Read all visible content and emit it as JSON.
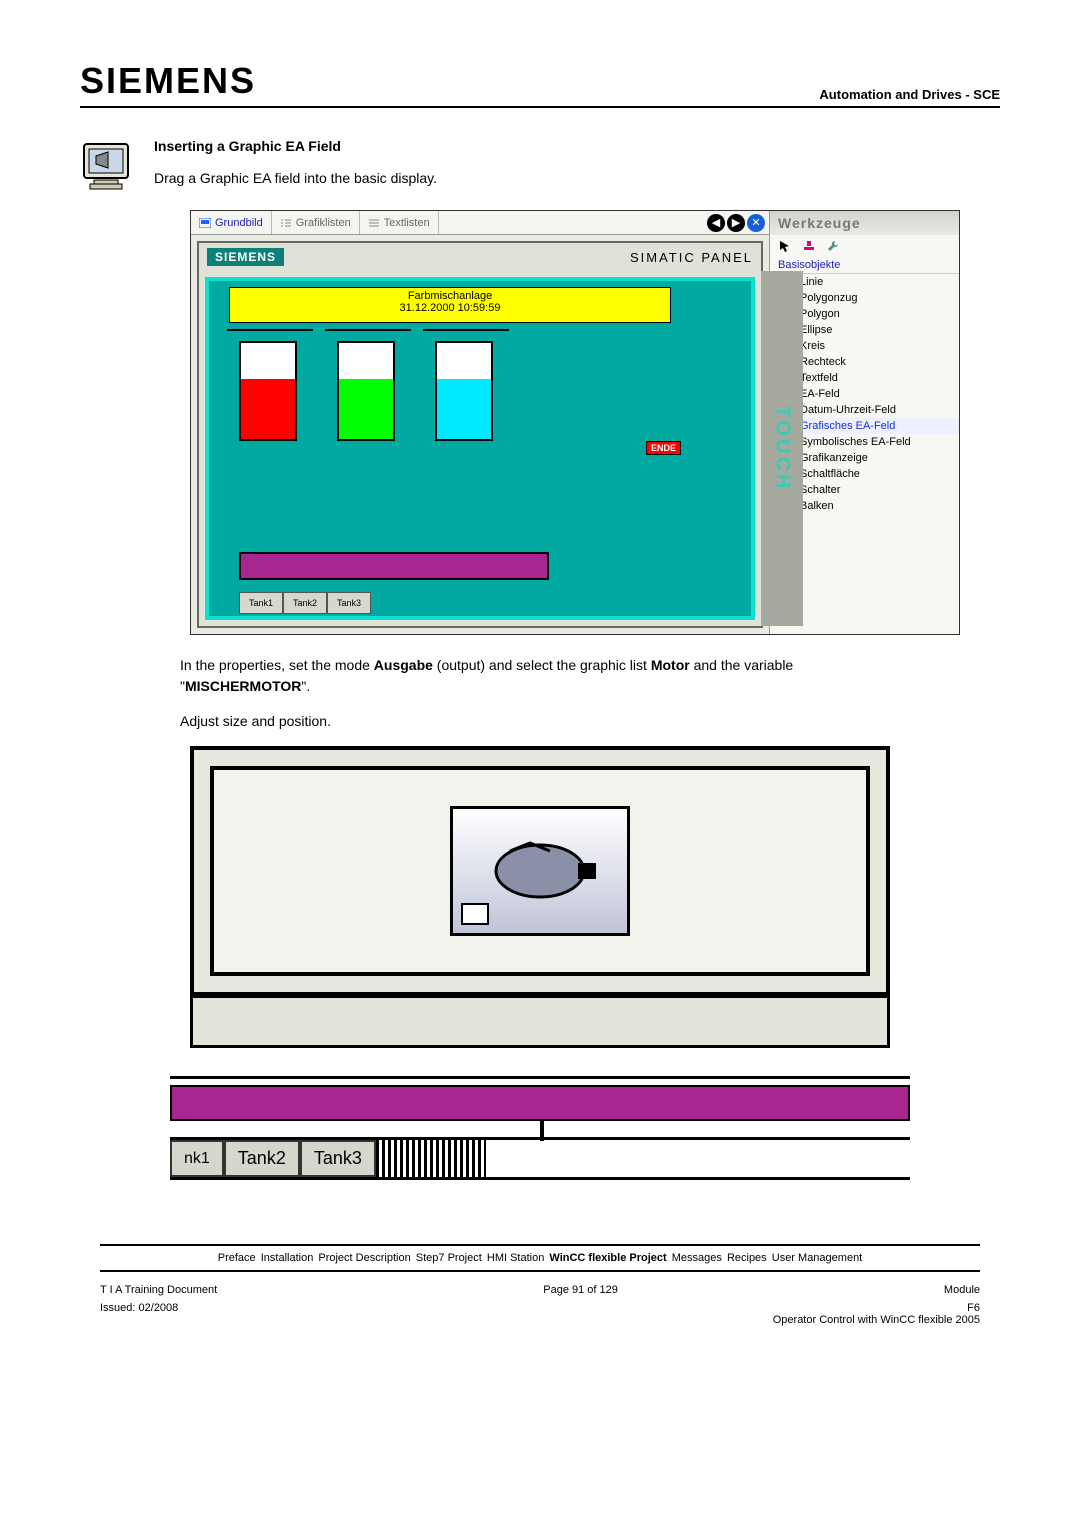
{
  "header": {
    "brand": "SIEMENS",
    "right": "Automation and Drives - SCE"
  },
  "section1": {
    "title": "Inserting a Graphic EA Field",
    "intro": "Drag a Graphic EA field into the basic display."
  },
  "screenshot1": {
    "tabs": {
      "grundbild": "Grundbild",
      "grafik": "Grafiklisten",
      "text": "Textlisten"
    },
    "panel": {
      "siemens": "SIEMENS",
      "title": "SIMATIC PANEL",
      "touch": "TOUCH"
    },
    "yellow": {
      "line1": "Farbmischanlage",
      "line2": "31.12.2000 10:59:59"
    },
    "ende": "ENDE",
    "tankbtns": [
      "Tank1",
      "Tank2",
      "Tank3"
    ],
    "tools": {
      "title": "Werkzeuge",
      "cat": "Basisobjekte",
      "items": [
        "Linie",
        "Polygonzug",
        "Polygon",
        "Ellipse",
        "Kreis",
        "Rechteck",
        "Textfeld",
        "EA-Feld",
        "Datum-Uhrzeit-Feld",
        "Grafisches EA-Feld",
        "Symbolisches EA-Feld",
        "Grafikanzeige",
        "Schaltfläche",
        "Schalter",
        "Balken"
      ]
    }
  },
  "para2": {
    "t1": "In the properties, set the mode ",
    "b1": "Ausgabe",
    "t2": " (output) and select the graphic list ",
    "b2": "Motor",
    "t3": " and the variable \"",
    "b3": "MISCHERMOTOR",
    "t4": "\".",
    "t5": "Adjust size and position."
  },
  "screenshot2": {
    "btns": [
      "nk1",
      "Tank2",
      "Tank3"
    ]
  },
  "breadcrumb": {
    "items": [
      "Preface",
      "Installation",
      "Project Description",
      "Step7 Project",
      "HMI Station",
      "WinCC flexible Project",
      "Messages",
      "Recipes",
      "User Management"
    ],
    "current_index": 5
  },
  "footer": {
    "l1_left": "T I A  Training Document",
    "l1_mid": "Page 91 of 129",
    "l1_right": "Module",
    "l2_left": "Issued: 02/2008",
    "l2_right1": "F6",
    "l2_right2": "Operator Control with WinCC flexible 2005"
  }
}
